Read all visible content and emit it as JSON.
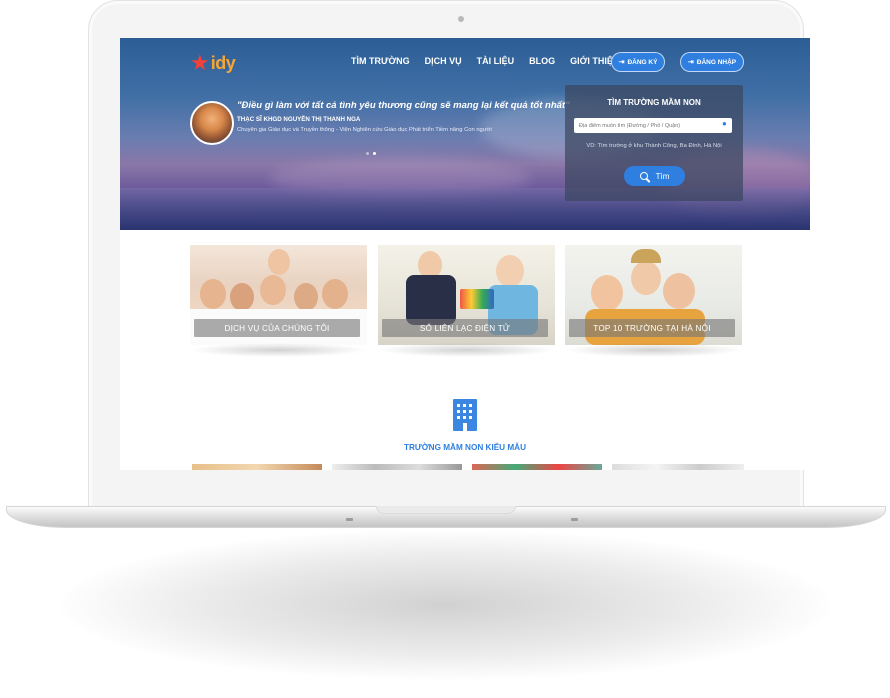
{
  "nav": {
    "logo_text": "idy",
    "items": [
      "TÌM TRƯỜNG",
      "DỊCH VỤ",
      "TÀI LIỆU",
      "BLOG",
      "GIỚI THIỆU"
    ],
    "register_label": "ĐĂNG KÝ",
    "login_label": "ĐĂNG NHẬP"
  },
  "hero": {
    "quote": "\"Điều gì làm với tất cả tình yêu thương cũng sẽ mang lại kết quả tốt nhất\"",
    "author": "THẠC SĨ KHGD NGUYỄN THỊ THANH NGA",
    "role": "Chuyên gia Giáo dục và Truyền thông - Viện Nghiên cứu Giáo dục Phát triển Tiềm năng Con người"
  },
  "search": {
    "title": "TÌM TRƯỜNG MẦM NON",
    "placeholder": "Địa điểm muốn tìm (Đường / Phố / Quận)",
    "hint": "VD: Tìm trường ở khu Thành Công, Ba Đình, Hà Nội",
    "button": "Tìm"
  },
  "cards": [
    {
      "label": "DỊCH VỤ CỦA CHÚNG TÔI"
    },
    {
      "label": "SỔ LIÊN LẠC ĐIỆN TỬ"
    },
    {
      "label": "TOP 10 TRƯỜNG TẠI HÀ NỘI"
    }
  ],
  "section": {
    "title": "TRƯỜNG MẦM NON KIỂU MẪU",
    "icon": "building-icon"
  },
  "colors": {
    "accent": "#2f7fe0",
    "logo_orange": "#f7a634",
    "logo_red": "#f0413c"
  }
}
